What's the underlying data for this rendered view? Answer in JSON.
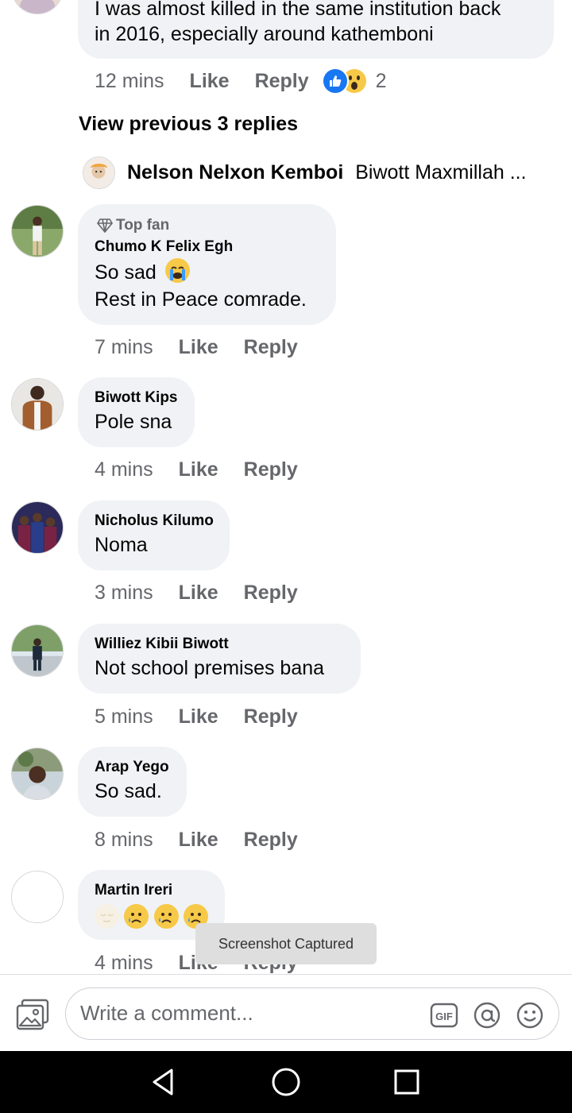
{
  "top_comment": {
    "text_line1": "I was almost killed in the same institution back",
    "text_line2": "in 2016, especially around kathemboni",
    "time": "12 mins",
    "like": "Like",
    "reply": "Reply",
    "reaction_count": "2"
  },
  "view_previous": "View previous 3 replies",
  "latest_reply": {
    "author": "Nelson Nelxon Kemboi",
    "preview": "Biwott Maxmillah ..."
  },
  "comments": [
    {
      "badge": "Top fan",
      "author": "Chumo K Felix Egh",
      "line1": "So sad",
      "line2": "Rest in Peace comrade.",
      "time": "7 mins",
      "like": "Like",
      "reply": "Reply"
    },
    {
      "author": "Biwott Kips",
      "line1": "Pole sna",
      "time": "4 mins",
      "like": "Like",
      "reply": "Reply"
    },
    {
      "author": "Nicholus Kilumo",
      "line1": "Noma",
      "time": "3 mins",
      "like": "Like",
      "reply": "Reply"
    },
    {
      "author": "Williez Kibii Biwott",
      "line1": "Not school premises bana",
      "time": "5 mins",
      "like": "Like",
      "reply": "Reply"
    },
    {
      "author": "Arap Yego",
      "line1": "So sad.",
      "time": "8 mins",
      "like": "Like",
      "reply": "Reply"
    },
    {
      "author": "Martin Ireri",
      "line1": "",
      "time": "4 mins",
      "like": "Like",
      "reply": "Reply"
    }
  ],
  "toast": "Screenshot Captured",
  "composer": {
    "placeholder": "Write a comment...",
    "gif_label": "GIF"
  },
  "icons": {
    "photo": "photo-icon",
    "gif": "gif-icon",
    "mention": "at-icon",
    "emoji": "emoji-icon",
    "back": "back-icon",
    "home": "home-icon",
    "recents": "recents-icon"
  },
  "colors": {
    "bubble": "#f0f2f5",
    "meta_text": "#65676b",
    "like_blue": "#1877f2",
    "emoji_yellow": "#f7c948"
  }
}
